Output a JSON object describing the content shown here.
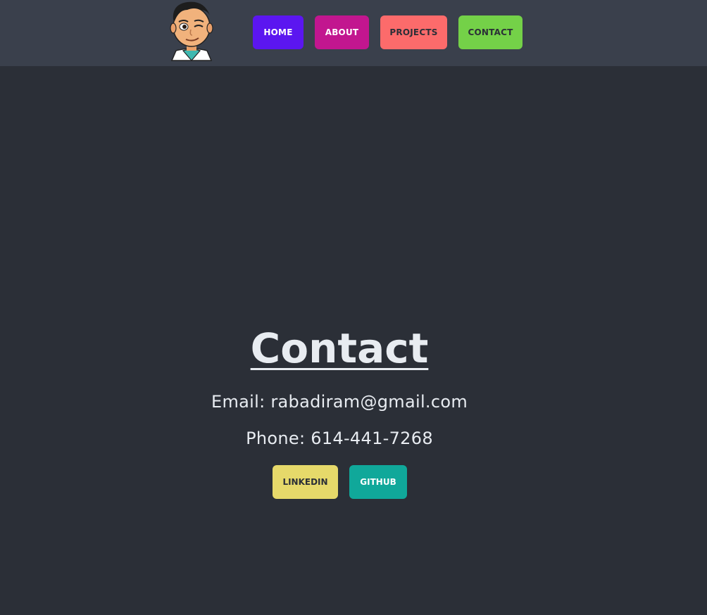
{
  "nav": {
    "home": "HOME",
    "about": "ABOUT",
    "projects": "PROJECTS",
    "contact": "CONTACT"
  },
  "contact": {
    "title": "Contact",
    "email": "Email: rabadiram@gmail.com",
    "phone": "Phone: 614-441-7268"
  },
  "social": {
    "linkedin": "LINKEDIN",
    "github": "GITHUB"
  },
  "colors": {
    "background": "#2b2f37",
    "navbar": "#3a404c",
    "home_btn": "#5b16f0",
    "about_btn": "#c2168f",
    "projects_btn": "#fc6b6b",
    "contact_btn": "#74d148",
    "linkedin_btn": "#e6d96a",
    "github_btn": "#10a89a"
  },
  "icons": {
    "avatar": "bitmoji-avatar-icon"
  }
}
